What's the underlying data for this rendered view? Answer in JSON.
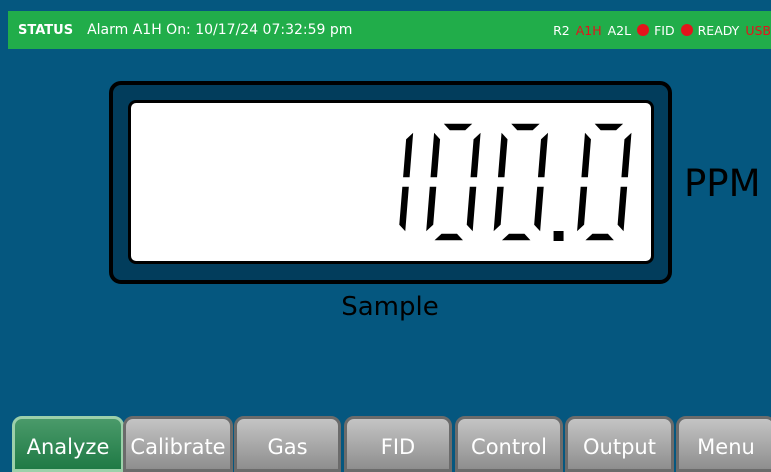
{
  "status": {
    "label": "STATUS",
    "message": "Alarm A1H On: 10/17/24 07:32:59 pm",
    "indicators": [
      "R2",
      "A1H",
      "A2L",
      "FID",
      "READY",
      "USB"
    ]
  },
  "display": {
    "value": "100.0",
    "unit": "PPM",
    "source": "Sample"
  },
  "tabs": [
    "Analyze",
    "Calibrate",
    "Gas",
    "FID",
    "Control",
    "Output",
    "Menu"
  ],
  "active_tab": "Analyze",
  "colors": {
    "status_bar": "#21ad4a",
    "background": "#05577f",
    "alarm": "#e3141b",
    "tab": "#a8a8a8",
    "active_tab": "#2a8a55"
  },
  "icons": [
    "red-dot-icon"
  ]
}
